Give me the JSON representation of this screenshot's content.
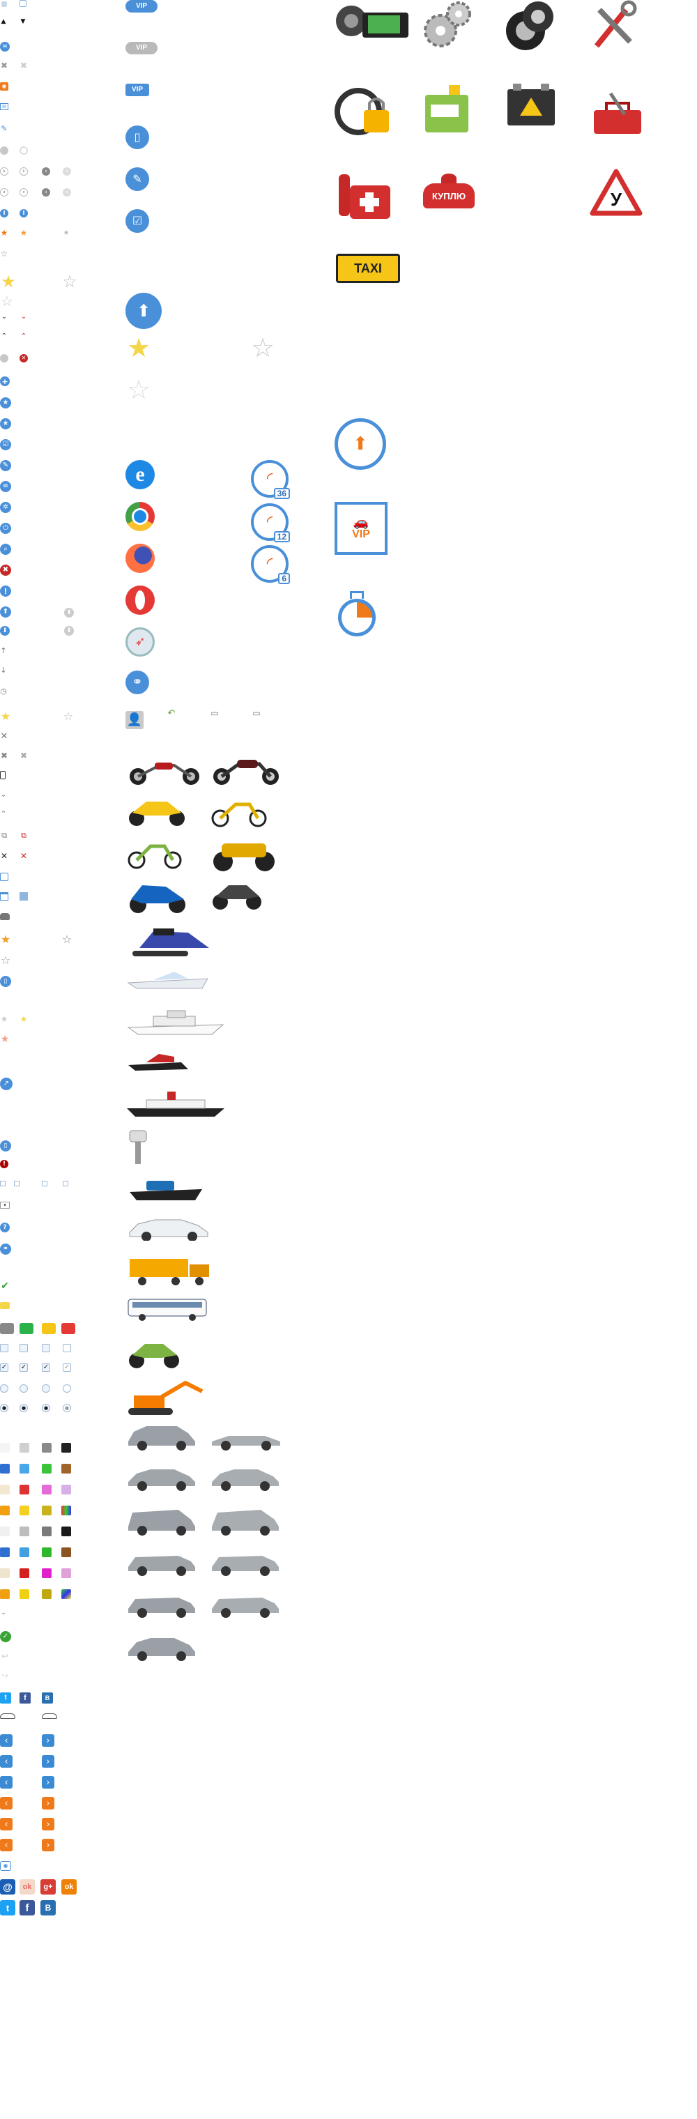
{
  "badges": {
    "vip_blue": "VIP",
    "vip_grey": "VIP",
    "vip_blue_plain": "VIP",
    "vip_box": "VIP"
  },
  "gauges": [
    "36",
    "12",
    "6"
  ],
  "taxi_sign": "TAXI",
  "kuplyu_sign": "КУПЛЮ",
  "road_sign_letter": "У",
  "social": {
    "vk": "В",
    "fb": "f",
    "gplus": "g+",
    "ok": "ok"
  },
  "colors": {
    "accent_blue": "#4a90d9",
    "accent_orange": "#f07a1a",
    "star_yellow": "#f5d64a",
    "danger_red": "#c62828"
  }
}
